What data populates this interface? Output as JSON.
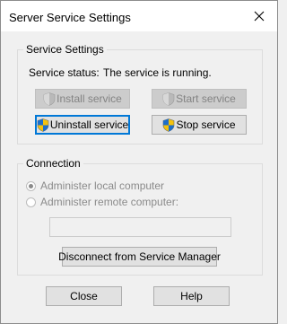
{
  "window": {
    "title": "Server Service Settings"
  },
  "service_settings": {
    "legend": "Service Settings",
    "status_label": "Service status:",
    "status_value": "The service is running.",
    "install_label": "Install service",
    "start_label": "Start service",
    "uninstall_label": "Uninstall service",
    "stop_label": "Stop service"
  },
  "connection": {
    "legend": "Connection",
    "local_label": "Administer local computer",
    "remote_label": "Administer remote computer:",
    "remote_value": "",
    "disconnect_label": "Disconnect from Service Manager"
  },
  "footer": {
    "close_label": "Close",
    "help_label": "Help"
  },
  "icons": {
    "close": "close-icon",
    "shield": "uac-shield-icon"
  }
}
